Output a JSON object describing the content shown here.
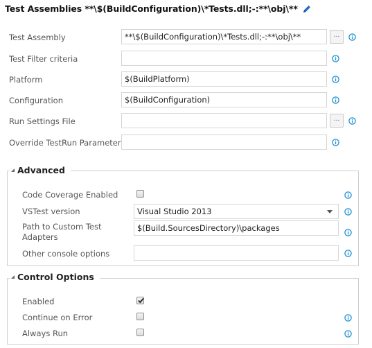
{
  "header": {
    "title": "Test Assemblies **\\$(BuildConfiguration)\\*Tests.dll;-:**\\obj\\**",
    "edit_icon": "pencil-icon"
  },
  "fields": [
    {
      "label": "Test Assembly",
      "value": "**\\$(BuildConfiguration)\\*Tests.dll;-:**\\obj\\**",
      "placeholder": "",
      "has_browse": true,
      "browse_label": "...",
      "info_icon": "info-icon"
    },
    {
      "label": "Test Filter criteria",
      "value": "",
      "placeholder": "",
      "has_browse": false,
      "info_icon": "info-icon"
    },
    {
      "label": "Platform",
      "value": "$(BuildPlatform)",
      "placeholder": "",
      "has_browse": false,
      "info_icon": "info-icon"
    },
    {
      "label": "Configuration",
      "value": "$(BuildConfiguration)",
      "placeholder": "",
      "has_browse": false,
      "info_icon": "info-icon"
    },
    {
      "label": "Run Settings File",
      "value": "",
      "placeholder": "",
      "has_browse": true,
      "browse_label": "...",
      "info_icon": "info-icon"
    },
    {
      "label": "Override TestRun Parameters",
      "value": "",
      "placeholder": "",
      "has_browse": false,
      "info_icon": "info-icon"
    }
  ],
  "advanced": {
    "title": "Advanced",
    "expanded": true,
    "code_coverage": {
      "label": "Code Coverage Enabled",
      "checked": false
    },
    "vstest_version": {
      "label": "VSTest version",
      "selected": "Visual Studio 2013"
    },
    "custom_adapters": {
      "label_line1": "Path to Custom Test",
      "label_line2": "Adapters",
      "value": "$(Build.SourcesDirectory)\\packages"
    },
    "console_options": {
      "label": "Other console options",
      "value": ""
    }
  },
  "control_options": {
    "title": "Control Options",
    "expanded": true,
    "enabled": {
      "label": "Enabled",
      "checked": true
    },
    "continue_on_error": {
      "label": "Continue on Error",
      "checked": false
    },
    "always_run": {
      "label": "Always Run",
      "checked": false
    }
  },
  "colors": {
    "accent": "#1e7ad0",
    "info": "#1e8fd6"
  }
}
